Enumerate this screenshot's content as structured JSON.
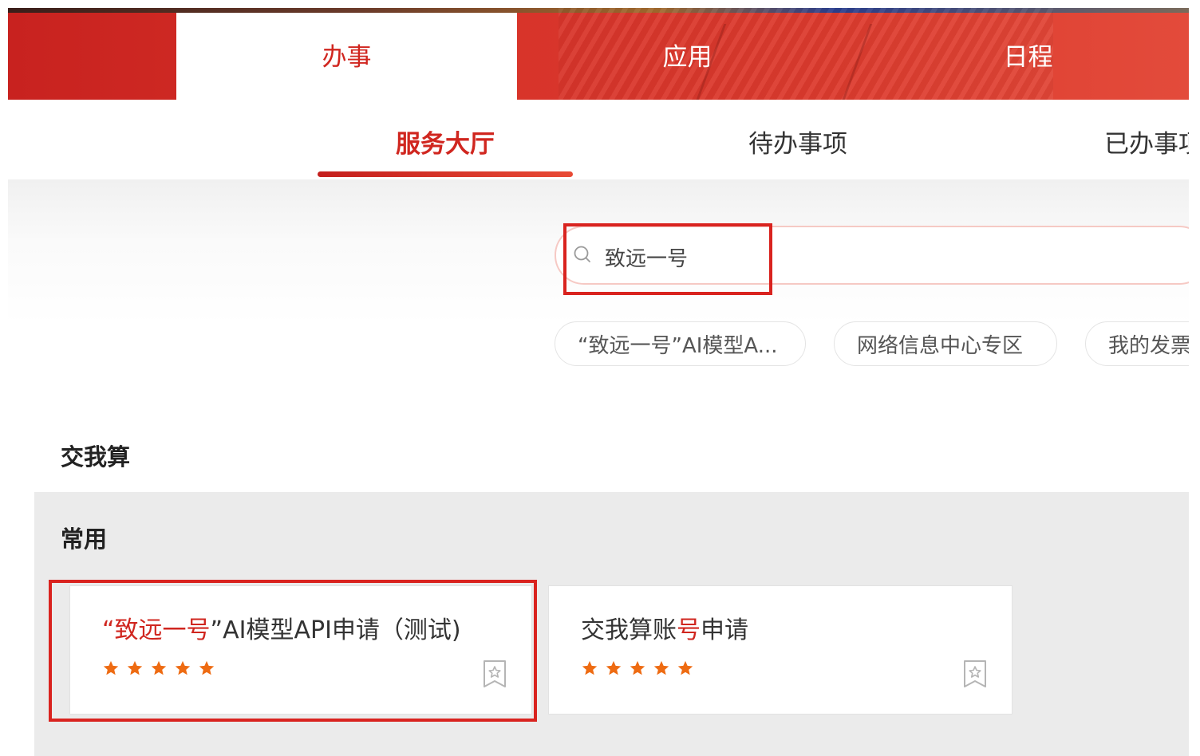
{
  "nav": {
    "tabs": [
      {
        "label": "办事",
        "active": true
      },
      {
        "label": "应用",
        "active": false
      },
      {
        "label": "日程",
        "active": false
      }
    ]
  },
  "subtabs": {
    "items": [
      {
        "label": "服务大厅",
        "active": true
      },
      {
        "label": "待办事项",
        "active": false
      },
      {
        "label": "已办事项",
        "active": false
      }
    ]
  },
  "search": {
    "value": "致远一号",
    "icon": "search-icon"
  },
  "chips": [
    {
      "label": "“致远一号”AI模型A..."
    },
    {
      "label": "网络信息中心专区"
    },
    {
      "label": "我的发票"
    }
  ],
  "sections": {
    "assign": "交我算",
    "common": "常用"
  },
  "cards": [
    {
      "title_pre": "",
      "title_hl": "“致远一号",
      "title_post": "”AI模型API申请（测试)",
      "rating": 5,
      "fav_icon": "bookmark-star-icon"
    },
    {
      "title_pre": "交我算账",
      "title_hl": "号",
      "title_post": "申请",
      "rating": 5,
      "fav_icon": "bookmark-star-icon"
    }
  ],
  "colors": {
    "brand_red": "#d0261f",
    "highlight_border": "#d9231f",
    "star": "#ee6b12"
  }
}
